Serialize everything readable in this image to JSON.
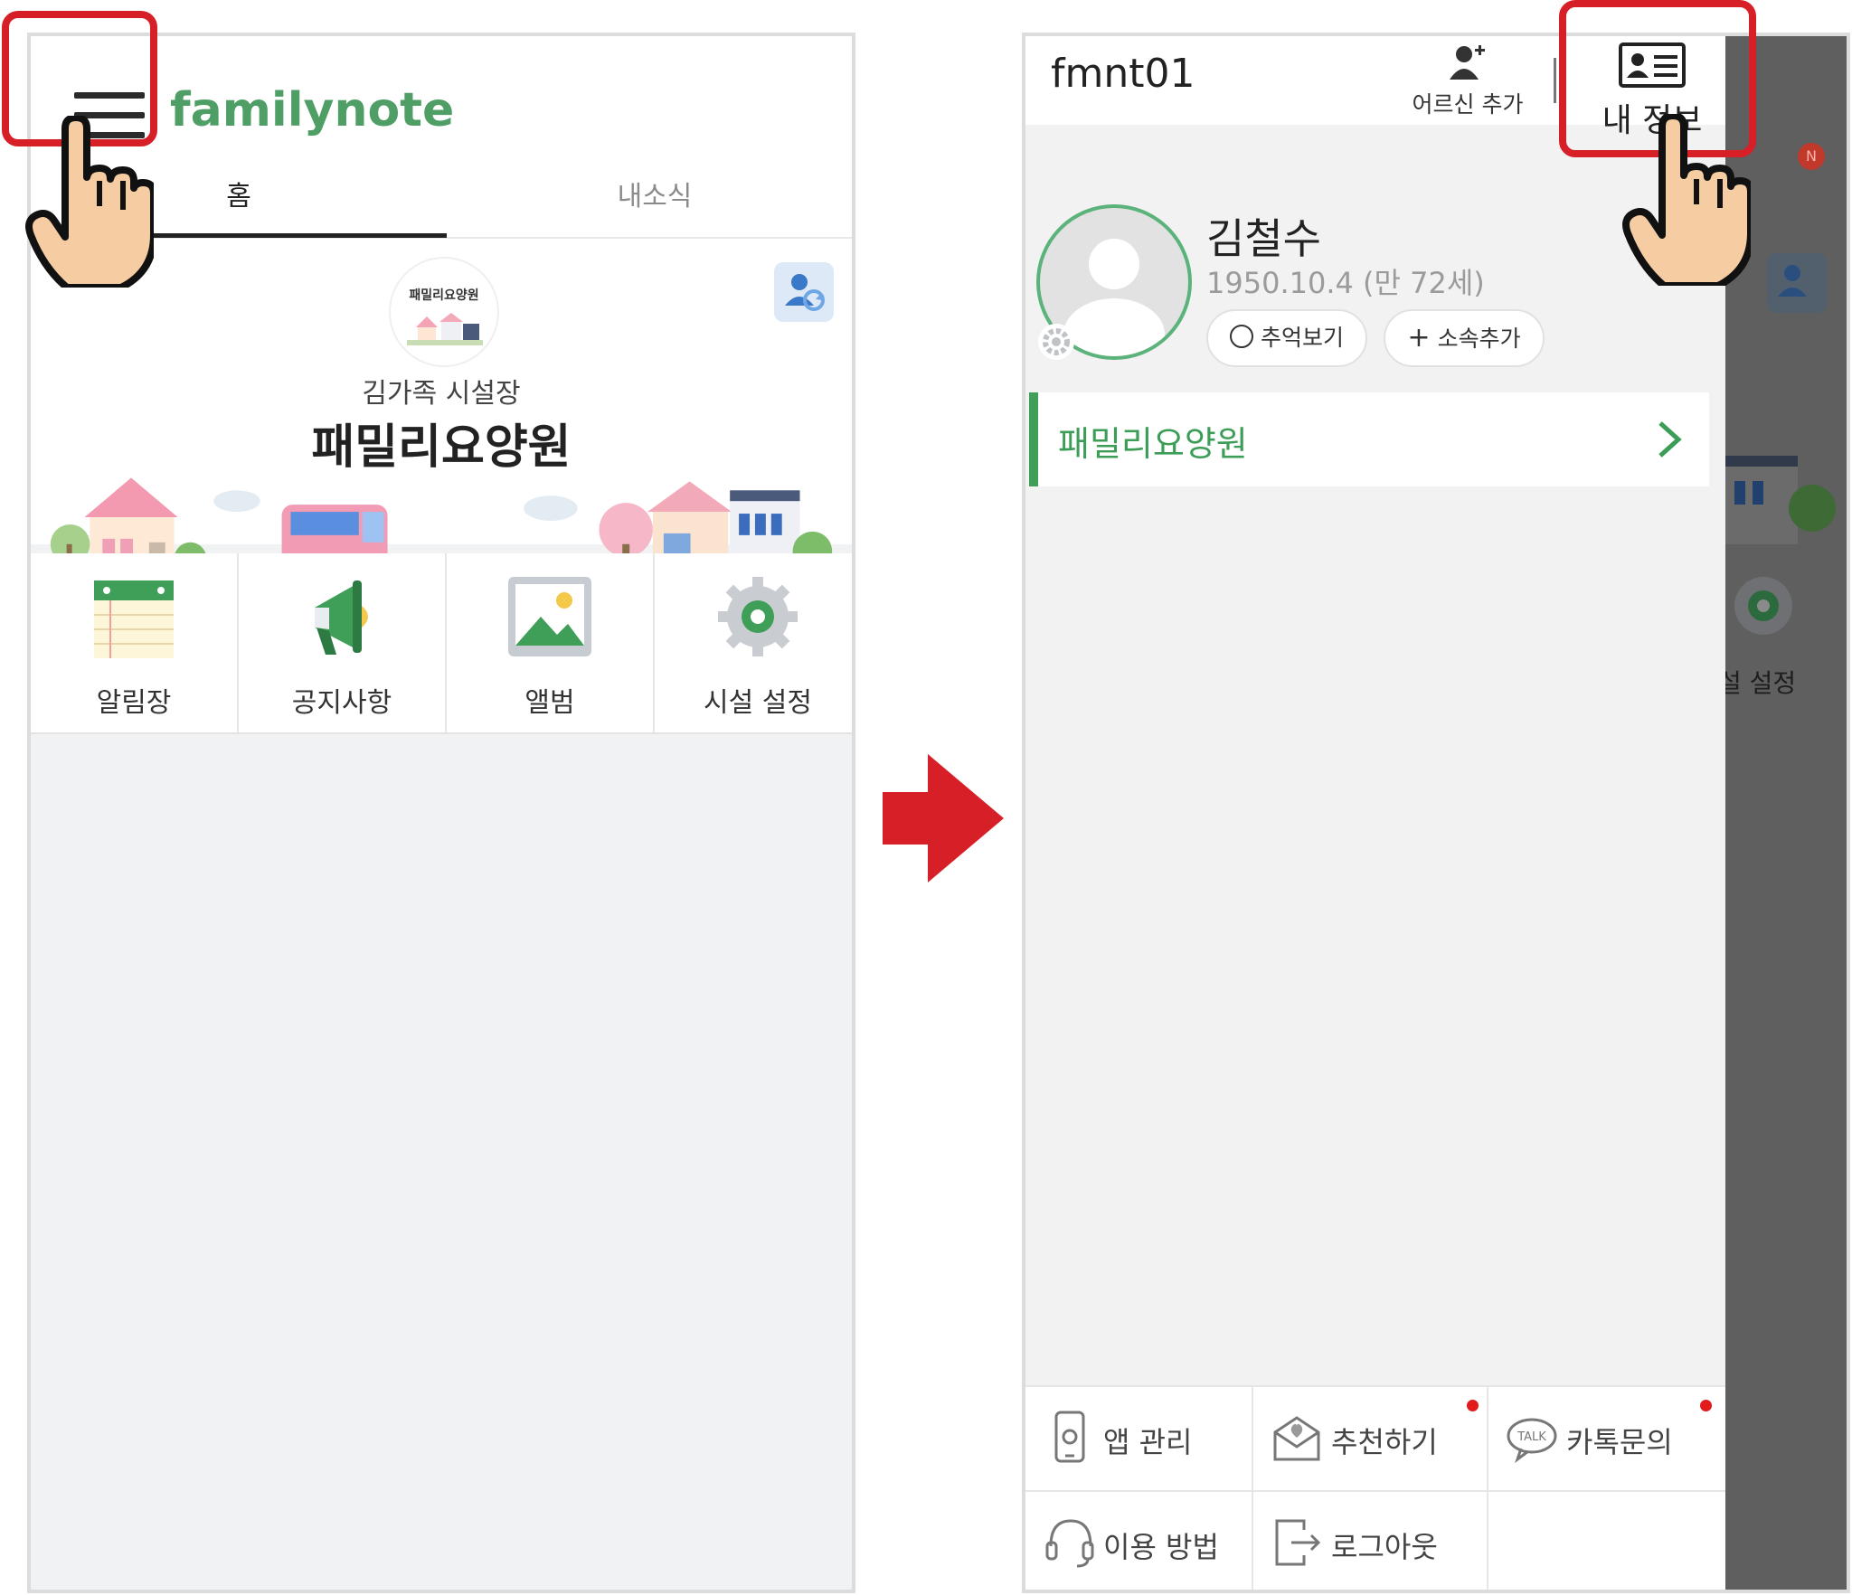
{
  "left_screen": {
    "logo": "familynote",
    "tabs": [
      {
        "label": "홈",
        "active": true
      },
      {
        "label": "내소식",
        "active": false
      }
    ],
    "facility_logo_text": "패밀리요양원",
    "director_label": "김가족 시설장",
    "facility_name": "패밀리요양원",
    "menu": [
      {
        "label": "알림장",
        "icon": "notebook-icon"
      },
      {
        "label": "공지사항",
        "icon": "megaphone-icon"
      },
      {
        "label": "앨범",
        "icon": "photo-icon"
      },
      {
        "label": "시설 설정",
        "icon": "gear-icon"
      }
    ]
  },
  "right_screen": {
    "header": {
      "user_id": "fmnt01",
      "add_senior_label": "어르신 추가",
      "my_info_label": "내 정보"
    },
    "profile": {
      "name": "김철수",
      "birth": "1950.10.4 (만 72세)",
      "memories_button": "추억보기",
      "add_affiliation_button": "소속추가"
    },
    "facility_row": "패밀리요양원",
    "bottom_menu": [
      {
        "label": "앱 관리",
        "icon": "phone-settings-icon",
        "badge": false
      },
      {
        "label": "추천하기",
        "icon": "envelope-heart-icon",
        "badge": true
      },
      {
        "label": "카톡문의",
        "icon": "kakao-talk-icon",
        "badge": true
      },
      {
        "label": "이용 방법",
        "icon": "headset-icon",
        "badge": false
      },
      {
        "label": "로그아웃",
        "icon": "logout-icon",
        "badge": false
      }
    ],
    "background": {
      "notification_badge": "N",
      "settings_label": "설 설정"
    }
  },
  "colors": {
    "brand_green": "#4f9e66",
    "highlight_red": "#d61f26",
    "arrow_red": "#d61f26",
    "badge_red": "#e11b1b"
  }
}
